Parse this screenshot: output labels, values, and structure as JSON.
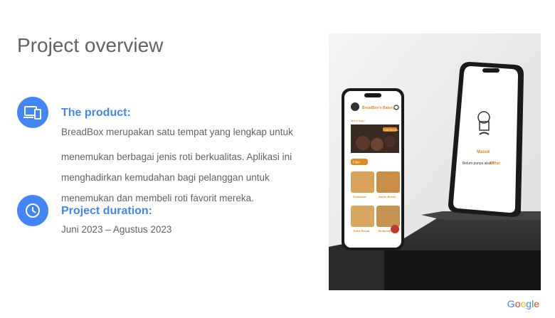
{
  "slide": {
    "title": "Project overview",
    "sections": [
      {
        "icon": "devices-icon",
        "heading": "The product:",
        "body_lines": [
          "BreadBox merupakan satu tempat yang lengkap untuk",
          "menemukan berbagai jenis roti berkualitas. Aplikasi ini",
          "menghadirkan kemudahan bagi pelanggan untuk",
          "menemukan dan membeli roti favorit mereka."
        ]
      },
      {
        "icon": "clock-icon",
        "heading": "Project duration:",
        "body_lines": [
          "Juni 2023 – Agustus 2023"
        ]
      }
    ]
  },
  "mockup": {
    "left_phone": {
      "app_title": "BreadBox's Bakery",
      "menu_label": "Menu Baru",
      "banner_badge": "Coba Sekarang",
      "filter_label": "Filter",
      "products": [
        "Croissant",
        "Garlic Bread",
        "Turtle Bread",
        "Brotchen"
      ]
    },
    "right_phone": {
      "login_label": "Masuk",
      "signup_prompt": "Belum punya akun?",
      "signup_link": "Daftar"
    }
  },
  "footer": {
    "logo": "Google"
  },
  "colors": {
    "accent_blue": "#4285f4",
    "text_gray": "#5f6368",
    "app_orange": "#e08a1e"
  }
}
